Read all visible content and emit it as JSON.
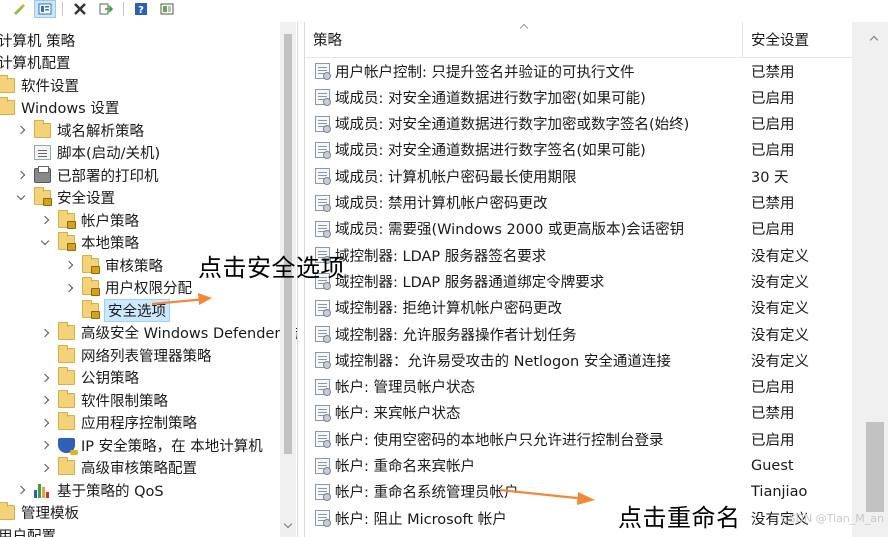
{
  "toolbar": {
    "buttons": [
      "edit-icon",
      "properties-icon",
      "delete-icon",
      "export-icon",
      "help-icon",
      "view-icon"
    ]
  },
  "tree": {
    "items": [
      {
        "label": "计算机 策略",
        "icon": "none",
        "indent": 0,
        "chevron": "none"
      },
      {
        "label": "计算机配置",
        "icon": "none",
        "indent": 0,
        "chevron": "none"
      },
      {
        "label": "软件设置",
        "icon": "folder",
        "indent": 1,
        "chevron": "none"
      },
      {
        "label": "Windows 设置",
        "icon": "folder",
        "indent": 1,
        "chevron": "none"
      },
      {
        "label": "域名解析策略",
        "icon": "folder",
        "indent": 2,
        "chevron": "right"
      },
      {
        "label": "脚本(启动/关机)",
        "icon": "script",
        "indent": 2,
        "chevron": "none"
      },
      {
        "label": "已部署的打印机",
        "icon": "printer",
        "indent": 2,
        "chevron": "right"
      },
      {
        "label": "安全设置",
        "icon": "lockfolder",
        "indent": 2,
        "chevron": "down"
      },
      {
        "label": "帐户策略",
        "icon": "lockfolder",
        "indent": 3,
        "chevron": "right"
      },
      {
        "label": "本地策略",
        "icon": "lockfolder",
        "indent": 3,
        "chevron": "down"
      },
      {
        "label": "审核策略",
        "icon": "lockfolder",
        "indent": 4,
        "chevron": "right"
      },
      {
        "label": "用户权限分配",
        "icon": "lockfolder",
        "indent": 4,
        "chevron": "right"
      },
      {
        "label": "安全选项",
        "icon": "lockfolder",
        "indent": 4,
        "chevron": "none",
        "selected": true
      },
      {
        "label": "高级安全 Windows Defender 防",
        "icon": "folder",
        "indent": 3,
        "chevron": "right"
      },
      {
        "label": "网络列表管理器策略",
        "icon": "folder",
        "indent": 3,
        "chevron": "none"
      },
      {
        "label": "公钥策略",
        "icon": "folder",
        "indent": 3,
        "chevron": "right"
      },
      {
        "label": "软件限制策略",
        "icon": "folder",
        "indent": 3,
        "chevron": "right"
      },
      {
        "label": "应用程序控制策略",
        "icon": "folder",
        "indent": 3,
        "chevron": "right"
      },
      {
        "label": "IP 安全策略，在 本地计算机",
        "icon": "shield",
        "indent": 3,
        "chevron": "right"
      },
      {
        "label": "高级审核策略配置",
        "icon": "folder",
        "indent": 3,
        "chevron": "right"
      },
      {
        "label": "基于策略的 QoS",
        "icon": "chart",
        "indent": 2,
        "chevron": "right"
      },
      {
        "label": "管理模板",
        "icon": "folder",
        "indent": 1,
        "chevron": "right"
      },
      {
        "label": "用户配置",
        "icon": "none",
        "indent": 0,
        "chevron": "none"
      }
    ]
  },
  "list": {
    "header_policy": "策略",
    "header_setting": "安全设置",
    "rows": [
      {
        "policy": "用户帐户控制: 只提升签名并验证的可执行文件",
        "setting": "已禁用"
      },
      {
        "policy": "域成员: 对安全通道数据进行数字加密(如果可能)",
        "setting": "已启用"
      },
      {
        "policy": "域成员: 对安全通道数据进行数字加密或数字签名(始终)",
        "setting": "已启用"
      },
      {
        "policy": "域成员: 对安全通道数据进行数字签名(如果可能)",
        "setting": "已启用"
      },
      {
        "policy": "域成员: 计算机帐户密码最长使用期限",
        "setting": "30 天"
      },
      {
        "policy": "域成员: 禁用计算机帐户密码更改",
        "setting": "已禁用"
      },
      {
        "policy": "域成员: 需要强(Windows 2000 或更高版本)会话密钥",
        "setting": "已启用"
      },
      {
        "policy": "域控制器: LDAP 服务器签名要求",
        "setting": "没有定义"
      },
      {
        "policy": "域控制器: LDAP 服务器通道绑定令牌要求",
        "setting": "没有定义"
      },
      {
        "policy": "域控制器: 拒绝计算机帐户密码更改",
        "setting": "没有定义"
      },
      {
        "policy": "域控制器: 允许服务器操作者计划任务",
        "setting": "没有定义"
      },
      {
        "policy": "域控制器：允许易受攻击的 Netlogon 安全通道连接",
        "setting": "没有定义"
      },
      {
        "policy": "帐户: 管理员帐户状态",
        "setting": "已启用"
      },
      {
        "policy": "帐户: 来宾帐户状态",
        "setting": "已禁用"
      },
      {
        "policy": "帐户: 使用空密码的本地帐户只允许进行控制台登录",
        "setting": "已启用"
      },
      {
        "policy": "帐户: 重命名来宾帐户",
        "setting": "Guest"
      },
      {
        "policy": "帐户: 重命名系统管理员帐户",
        "setting": "Tianjiao"
      },
      {
        "policy": "帐户: 阻止 Microsoft 帐户",
        "setting": "没有定义"
      }
    ]
  },
  "annotations": {
    "select_security_options": "点击安全选项",
    "click_rename": "点击重命名",
    "arrow_color": "#f08a3a"
  },
  "watermark": "CSDN @Tian_M_an"
}
